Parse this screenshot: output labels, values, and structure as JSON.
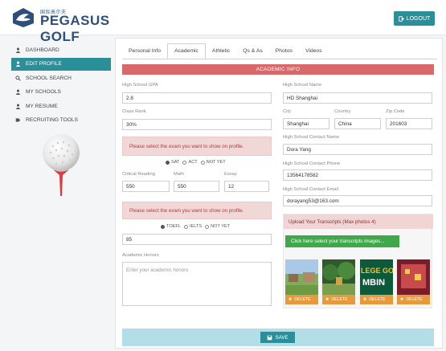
{
  "header": {
    "logo_small": "国际高尔夫",
    "logo_text_1": "PEGASUS",
    "logo_text_2": "GOLF",
    "logout_label": "LOGOUT"
  },
  "sidebar": {
    "items": [
      {
        "label": "DASHBOARD",
        "icon": "user-icon"
      },
      {
        "label": "EDIT PROFILE",
        "icon": "user-edit-icon"
      },
      {
        "label": "SCHOOL SEARCH",
        "icon": "search-icon"
      },
      {
        "label": "MY SCHOOLS",
        "icon": "user-icon"
      },
      {
        "label": "MY RESUME",
        "icon": "user-icon"
      },
      {
        "label": "RECRUITING TOOLS",
        "icon": "tag-icon"
      }
    ],
    "active_index": 1
  },
  "tabs": [
    {
      "label": "Personal Info"
    },
    {
      "label": "Academic"
    },
    {
      "label": "Athletic"
    },
    {
      "label": "Qs & As"
    },
    {
      "label": "Photos"
    },
    {
      "label": "Videos"
    }
  ],
  "banner": "ACADEMIC INFO",
  "left": {
    "gpa_label": "High School GPA",
    "gpa_value": "2.8",
    "rank_label": "Class Rank",
    "rank_value": "30%",
    "exam_notice_1": "Please select the exam you want to show on profile.",
    "exam_options_1": [
      "SAT",
      "ACT",
      "NOT YET"
    ],
    "reading_label": "Critical Reading",
    "reading_value": "550",
    "math_label": "Math",
    "math_value": "550",
    "essay_label": "Essay",
    "essay_value": "12",
    "exam_notice_2": "Please select the exam you want to show on profile.",
    "exam_options_2": [
      "TOEFL",
      "IELTS",
      "NOT YET"
    ],
    "toefl_value": "85",
    "honors_label": "Academic Honors",
    "honors_placeholder": "Enter your academic honors"
  },
  "right": {
    "school_name_label": "High School Name",
    "school_name_value": "HD Shanghai",
    "city_label": "City",
    "city_value": "Shanghai",
    "country_label": "Country",
    "country_value": "China",
    "zip_label": "Zip Code",
    "zip_value": "201603",
    "contact_name_label": "High School Contact Name",
    "contact_name_value": "Dora Yang",
    "contact_phone_label": "High School Contact Phone",
    "contact_phone_value": "13564178582",
    "contact_email_label": "High School Contact Email",
    "contact_email_value": "dorayang53@163.com",
    "upload_title": "Upload Your Transcripts (Max photos 4)",
    "upload_button": "Click here select your transcripts images...",
    "thumb_text_1": "LEGE GO",
    "thumb_text_2": "MBIN",
    "delete_label": "DELETE"
  },
  "save_label": "SAVE",
  "colors": {
    "accent": "#2b8f9a",
    "banner": "#d9686b",
    "notice_bg": "#f2d7d7",
    "upload_green": "#3fa84a",
    "delete_orange": "#e79a3b",
    "save_bar": "#b3dde7"
  }
}
